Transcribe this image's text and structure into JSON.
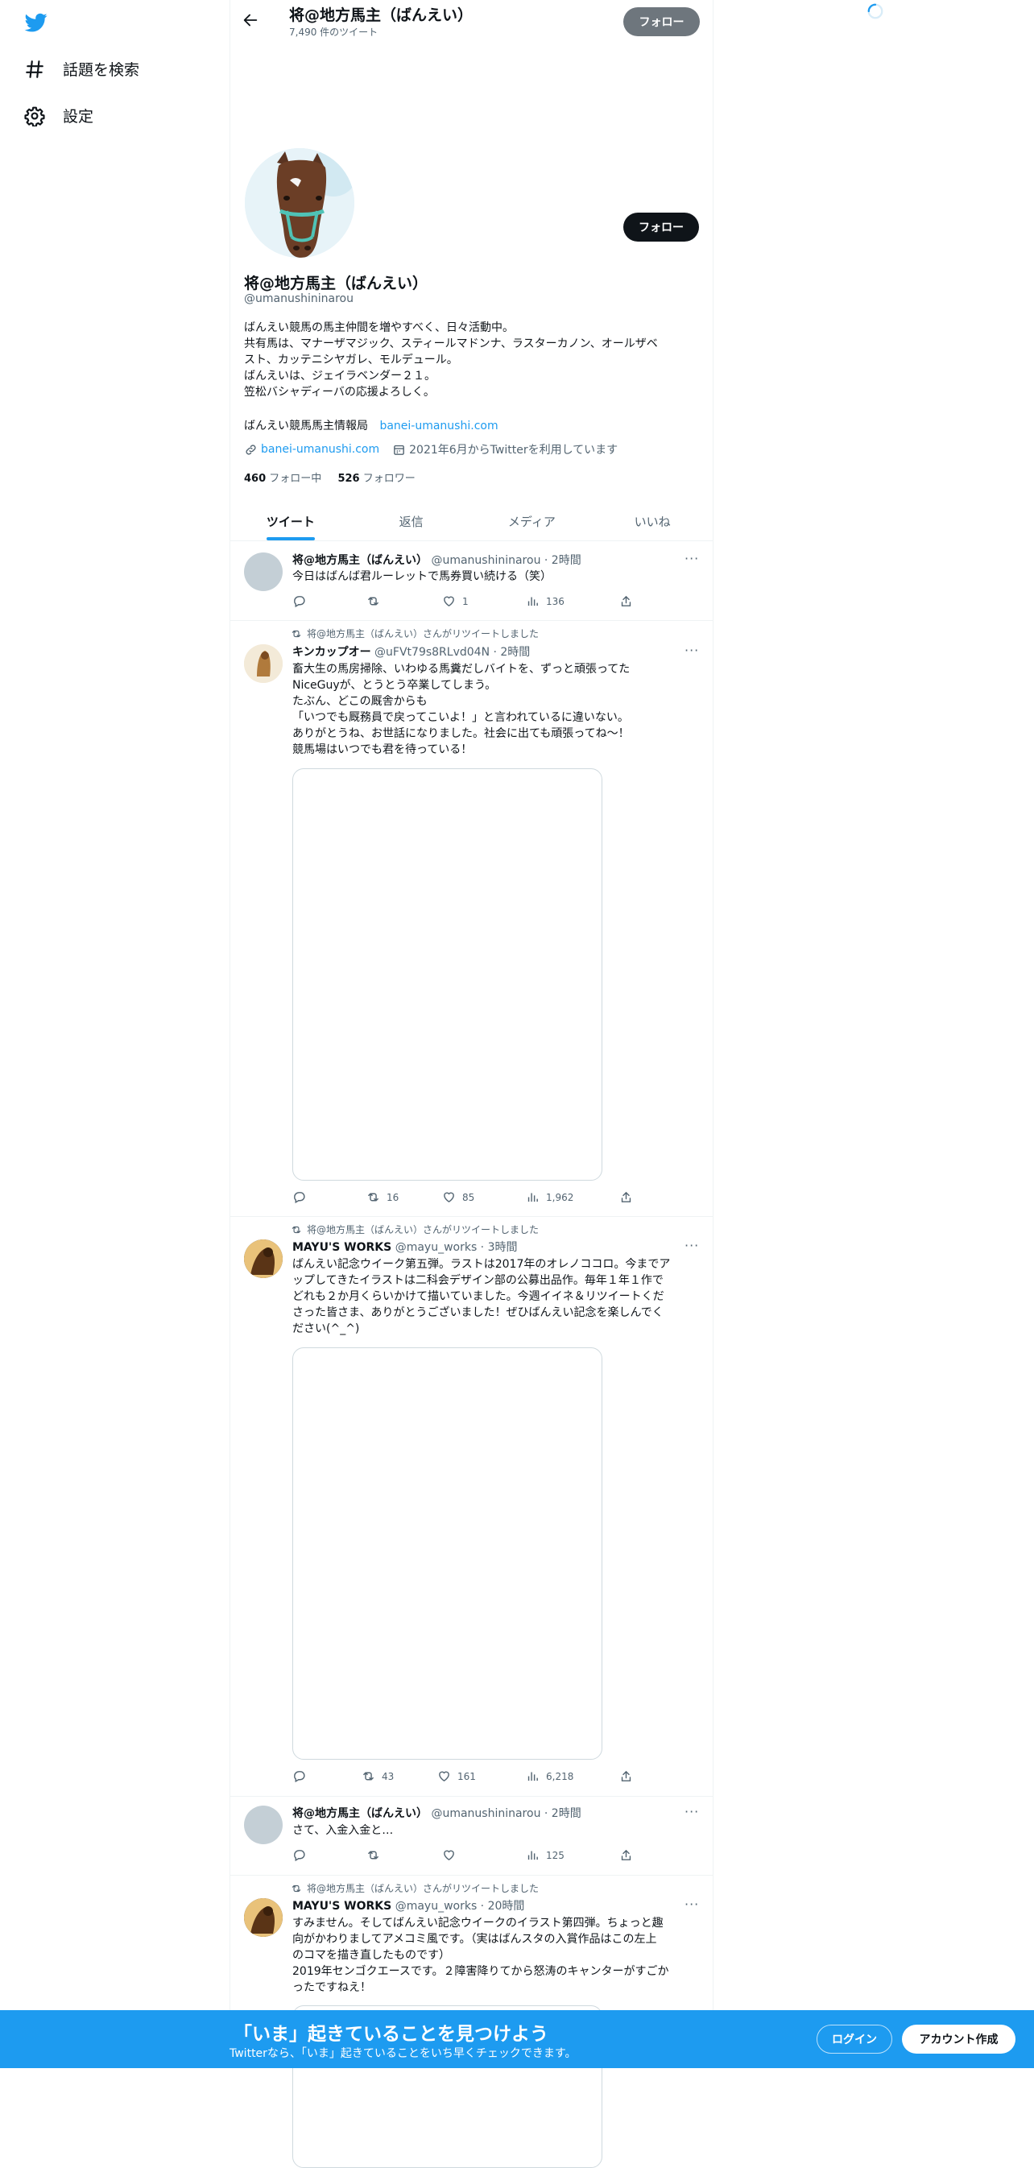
{
  "sidebar": {
    "items": [
      {
        "label": "話題を検索",
        "icon": "hashtag-icon"
      },
      {
        "label": "設定",
        "icon": "gear-icon"
      }
    ]
  },
  "header": {
    "name": "将@地方馬主（ばんえい）",
    "tweet_count": "7,490 件のツイート",
    "follow_label": "フォロー"
  },
  "profile": {
    "name": "将@地方馬主（ばんえい）",
    "handle": "@umanushininarou",
    "follow_label": "フォロー",
    "bio_lines": [
      "ばんえい競馬の馬主仲間を増やすべく、日々活動中。",
      "共有馬は、マナーザマジック、スティールマドンナ、ラスターカノン、オールザベ",
      "スト、カッテニシヤガレ、モルデュール。",
      "ばんえいは、ジェイラベンダー２１。",
      "笠松バシャディーバの応援よろしく。"
    ],
    "bio_extra": "ばんえい競馬馬主情報局",
    "bio_link": "banei-umanushi.com",
    "website": "banei-umanushi.com",
    "joined": "2021年6月からTwitterを利用しています",
    "following_count": "460",
    "following_label": "フォロー中",
    "followers_count": "526",
    "followers_label": "フォロワー"
  },
  "tabs": [
    "ツイート",
    "返信",
    "メディア",
    "いいね"
  ],
  "tweets": [
    {
      "name": "将@地方馬主（ばんえい）",
      "handle": "@umanushininarou · 2時間",
      "text": [
        "今日はばんば君ルーレットで馬券買い続ける（笑）"
      ],
      "retweets": "",
      "likes": "1",
      "views": "136"
    },
    {
      "retweet_by": "将@地方馬主（ばんえい）さんがリツイートしました",
      "name": "キンカップオー",
      "handle": "@uFVt79s8RLvd04N · 2時間",
      "text": [
        "畜大生の馬房掃除、いわゆる馬糞だしバイトを、ずっと頑張ってた",
        "NiceGuyが、とうとう卒業してしまう。",
        "たぶん、どこの厩舎からも",
        "「いつでも厩務員で戻ってこいよ！」と言われているに違いない。",
        "ありがとうね、お世話になりました。社会に出ても頑張ってね～！",
        "競馬場はいつでも君を待っている！"
      ],
      "retweets": "16",
      "likes": "85",
      "views": "1,962"
    },
    {
      "retweet_by": "将@地方馬主（ばんえい）さんがリツイートしました",
      "name": "MAYU'S WORKS",
      "handle": "@mayu_works · 3時間",
      "text": [
        "ばんえい記念ウイーク第五弾。ラストは2017年のオレノココロ。今までア",
        "ップしてきたイラストは二科会デザイン部の公募出品作。毎年１年１作で",
        "どれも２か月くらいかけて描いていました。今週イイネ＆リツイートくだ",
        "さった皆さま、ありがとうございました！ぜひばんえい記念を楽しんでく",
        "ださい(^_^)"
      ],
      "retweets": "43",
      "likes": "161",
      "views": "6,218"
    },
    {
      "name": "将@地方馬主（ばんえい）",
      "handle": "@umanushininarou · 2時間",
      "text": [
        "さて、入金入金と…"
      ],
      "retweets": "",
      "likes": "",
      "views": "125"
    },
    {
      "retweet_by": "将@地方馬主（ばんえい）さんがリツイートしました",
      "name": "MAYU'S WORKS",
      "handle": "@mayu_works · 20時間",
      "text": [
        "すみません。そしてばんえい記念ウイークのイラスト第四弾。ちょっと趣",
        "向がかわりましてアメコミ風です。（実はばんスタの入賞作品はこの左上",
        "のコマを描き直したものです）",
        "2019年センゴクエースです。２障害降りてから怒涛のキャンターがすごか",
        "ったですねえ！"
      ]
    }
  ],
  "bottom_bar": {
    "title": "「いま」起きていることを見つけよう",
    "subtitle": "Twitterなら、「いま」起きていることをいち早くチェックできます。",
    "login_label": "ログイン",
    "signup_label": "アカウント作成"
  },
  "colors": {
    "accent": "#1d9bf0",
    "text_secondary": "#536471",
    "border": "#eff3f4"
  }
}
